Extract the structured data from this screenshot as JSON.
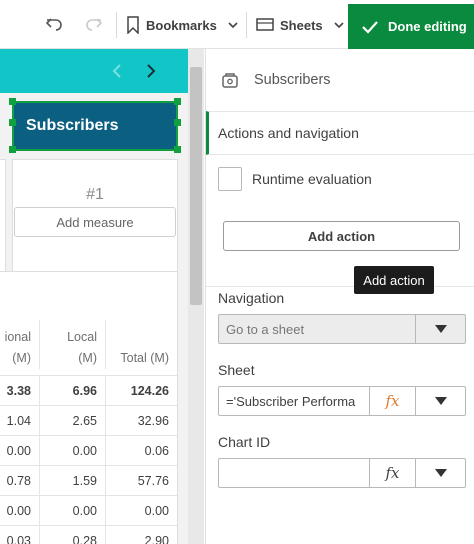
{
  "toolbar": {
    "bookmarks_label": "Bookmarks",
    "sheets_label": "Sheets",
    "done_label": "Done editing",
    "icons": [
      "undo-icon",
      "redo-icon",
      "bookmark-icon",
      "sheet-icon",
      "check-icon"
    ]
  },
  "canvas": {
    "title": "Subscribers",
    "kpi_number": "#1",
    "add_measure_label": "Add measure",
    "table": {
      "headers": [
        {
          "line1": "ional",
          "line2": "(M)"
        },
        {
          "line1": "Local",
          "line2": "(M)"
        },
        {
          "line1": "",
          "line2": "Total (M)"
        }
      ],
      "total_row": [
        "3.38",
        "6.96",
        "124.26"
      ],
      "rows": [
        [
          "1.04",
          "2.65",
          "32.96"
        ],
        [
          "0.00",
          "0.00",
          "0.06"
        ],
        [
          "0.78",
          "1.59",
          "57.76"
        ],
        [
          "0.00",
          "0.00",
          "0.00"
        ],
        [
          "0.03",
          "0.28",
          "2.90"
        ]
      ]
    }
  },
  "panel": {
    "header_title": "Subscribers",
    "section_title": "Actions and navigation",
    "runtime_label": "Runtime evaluation",
    "add_action_label": "Add action",
    "tooltip_text": "Add action",
    "navigation_label": "Navigation",
    "navigation_value": "Go to a sheet",
    "sheet_label": "Sheet",
    "sheet_value": "='Subscriber Performa",
    "chart_id_label": "Chart ID",
    "chart_id_value": "",
    "fx_label": "fx"
  },
  "colors": {
    "accent_green": "#0a8a3e",
    "teal": "#12c6c8",
    "title_bg": "#0b5f80"
  }
}
